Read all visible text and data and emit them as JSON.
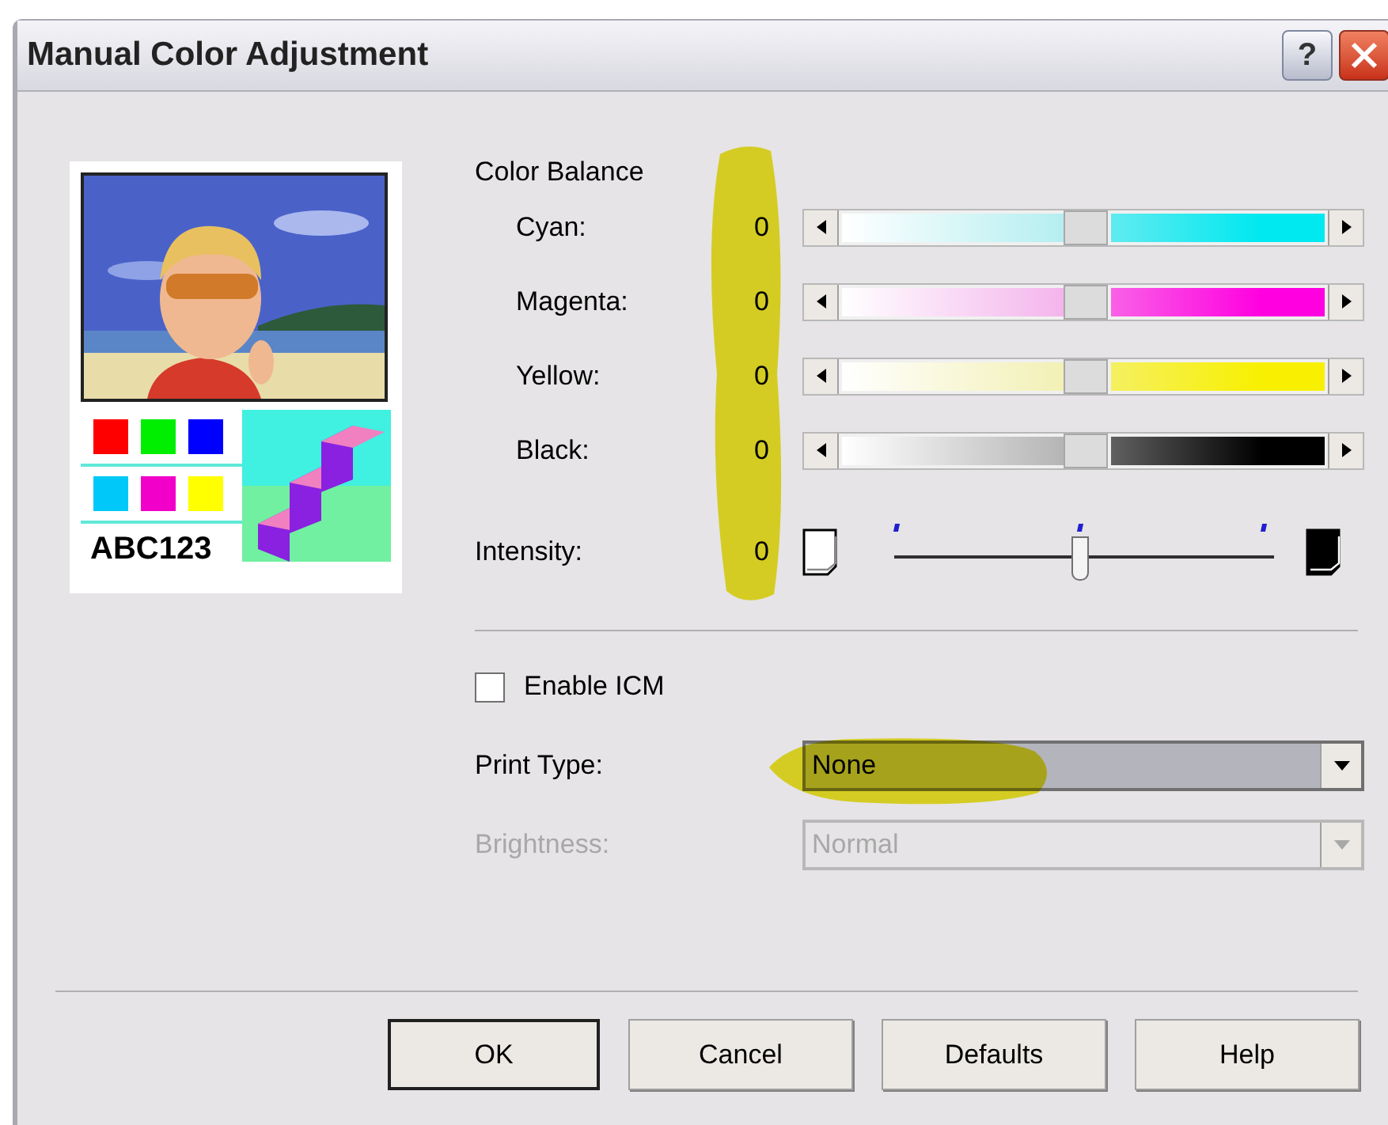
{
  "window": {
    "title": "Manual Color Adjustment",
    "help_label": "?"
  },
  "preview": {
    "sample_text": "ABC123"
  },
  "color_balance": {
    "heading": "Color Balance",
    "channels": [
      {
        "name": "Cyan:",
        "value": "0",
        "level": 0.5,
        "color": "#00e8f0"
      },
      {
        "name": "Magenta:",
        "value": "0",
        "level": 0.5,
        "color": "#ff00e0"
      },
      {
        "name": "Yellow:",
        "value": "0",
        "level": 0.5,
        "color": "#f8f000"
      },
      {
        "name": "Black:",
        "value": "0",
        "level": 0.5,
        "color": "#000000"
      }
    ]
  },
  "intensity": {
    "label": "Intensity:",
    "value": "0",
    "level": 0.5
  },
  "enable_icm": {
    "label": "Enable ICM",
    "checked": false
  },
  "dropdowns": [
    {
      "label": "Print Type:",
      "value": "None",
      "highlighted": true,
      "disabled": false
    },
    {
      "label": "Brightness:",
      "value": "Normal",
      "highlighted": false,
      "disabled": true
    }
  ],
  "buttons": [
    {
      "label": "OK",
      "default": true
    },
    {
      "label": "Cancel",
      "default": false
    },
    {
      "label": "Defaults",
      "default": false
    },
    {
      "label": "Help",
      "default": false
    }
  ]
}
